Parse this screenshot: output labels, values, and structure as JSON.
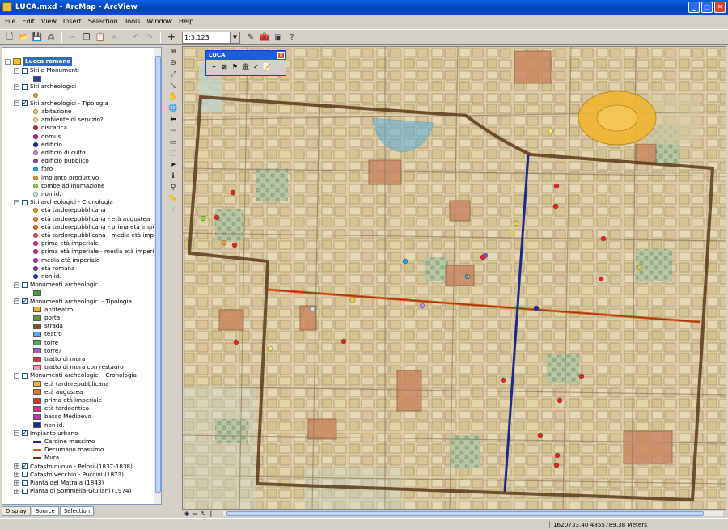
{
  "window": {
    "title": "LUCA.mxd - ArcMap - ArcView"
  },
  "menu": [
    "File",
    "Edit",
    "View",
    "Insert",
    "Selection",
    "Tools",
    "Window",
    "Help"
  ],
  "toolbar": {
    "scale": "1:3.123"
  },
  "luca_toolbar": {
    "title": "LUCA"
  },
  "toc": {
    "root": "Lucca romana",
    "rows": [
      {
        "type": "group",
        "label": "Siti e Monumenti",
        "checked": false
      },
      {
        "type": "sym",
        "sym": "sq",
        "color": "#1c3fae",
        "label": ""
      },
      {
        "type": "group",
        "label": "Siti archeologici",
        "checked": false
      },
      {
        "type": "sym",
        "sym": "dot",
        "color": "#e5a024",
        "label": ""
      },
      {
        "type": "group",
        "label": "Siti archeologici - Tipologia",
        "checked": true
      },
      {
        "type": "sym",
        "sym": "dot",
        "color": "#e6d24a",
        "label": "abitazione"
      },
      {
        "type": "sym",
        "sym": "dot",
        "color": "#ecec70",
        "label": "ambiente di servizio?"
      },
      {
        "type": "sym",
        "sym": "dot",
        "color": "#e0261f",
        "label": "discarica"
      },
      {
        "type": "sym",
        "sym": "dot",
        "color": "#c01f6e",
        "label": "domus"
      },
      {
        "type": "sym",
        "sym": "dot",
        "color": "#1b2aa0",
        "label": "edificio"
      },
      {
        "type": "sym",
        "sym": "dot",
        "color": "#c48ae4",
        "label": "edificio di culto"
      },
      {
        "type": "sym",
        "sym": "dot",
        "color": "#9b44c2",
        "label": "edificio pubblico"
      },
      {
        "type": "sym",
        "sym": "dot",
        "color": "#1da6e0",
        "label": "foro"
      },
      {
        "type": "sym",
        "sym": "dot",
        "color": "#e89a2a",
        "label": "impianto produttivo"
      },
      {
        "type": "sym",
        "sym": "dot",
        "color": "#8ad63c",
        "label": "tombe ad inumazione"
      },
      {
        "type": "sym",
        "sym": "dot",
        "color": "#c8e8e8",
        "label": "non id."
      },
      {
        "type": "group",
        "label": "Siti archeologici - Cronologia",
        "checked": false
      },
      {
        "type": "sym",
        "sym": "dot",
        "color": "#e5a024",
        "label": "età tardorepubblicana"
      },
      {
        "type": "sym",
        "sym": "dot",
        "color": "#e58a24",
        "label": "età tardorepubblicana - età augustea"
      },
      {
        "type": "sym",
        "sym": "dot",
        "color": "#e07030",
        "label": "età tardorepubblicana - prima età imperiale"
      },
      {
        "type": "sym",
        "sym": "dot",
        "color": "#e05050",
        "label": "età tardorepubblicana - media età imperiale"
      },
      {
        "type": "sym",
        "sym": "dot",
        "color": "#e0307a",
        "label": "prima età imperiale"
      },
      {
        "type": "sym",
        "sym": "dot",
        "color": "#d02a8a",
        "label": "prima età imperiale - media età imperiale"
      },
      {
        "type": "sym",
        "sym": "dot",
        "color": "#b0309e",
        "label": "media età imperiale"
      },
      {
        "type": "sym",
        "sym": "dot",
        "color": "#8030b0",
        "label": "età romana"
      },
      {
        "type": "sym",
        "sym": "dot",
        "color": "#2040c0",
        "label": "non id."
      },
      {
        "type": "group",
        "label": "Monumenti archeologici",
        "checked": false
      },
      {
        "type": "sym",
        "sym": "sq",
        "color": "#42a33a",
        "label": ""
      },
      {
        "type": "group",
        "label": "Monumenti archeologici - Tipologia",
        "checked": true
      },
      {
        "type": "sym",
        "sym": "sq",
        "color": "#f0b732",
        "label": "anfiteatro"
      },
      {
        "type": "sym",
        "sym": "sq",
        "color": "#5f9a37",
        "label": "porta"
      },
      {
        "type": "sym",
        "sym": "sq",
        "color": "#7d5030",
        "label": "strada"
      },
      {
        "type": "sym",
        "sym": "sq",
        "color": "#5ab0dd",
        "label": "teatro"
      },
      {
        "type": "sym",
        "sym": "sq",
        "color": "#4aa95a",
        "label": "torre"
      },
      {
        "type": "sym",
        "sym": "sq",
        "color": "#a060c0",
        "label": "torre?"
      },
      {
        "type": "sym",
        "sym": "sq",
        "color": "#d73838",
        "label": "tratto di mura"
      },
      {
        "type": "sym",
        "sym": "sq",
        "color": "#f09ab8",
        "label": "tratto di mura con restauro"
      },
      {
        "type": "group",
        "label": "Monumenti archeologici - Cronologia",
        "checked": false
      },
      {
        "type": "sym",
        "sym": "sq",
        "color": "#f0b732",
        "label": "età tardorepubblicana"
      },
      {
        "type": "sym",
        "sym": "sq",
        "color": "#e5761c",
        "label": "età augustea"
      },
      {
        "type": "sym",
        "sym": "sq",
        "color": "#e03030",
        "label": "prima età imperiale"
      },
      {
        "type": "sym",
        "sym": "sq",
        "color": "#e0308a",
        "label": "età tardoantica"
      },
      {
        "type": "sym",
        "sym": "sq",
        "color": "#c03aa0",
        "label": "basso Medioevo"
      },
      {
        "type": "sym",
        "sym": "sq",
        "color": "#1a2a90",
        "label": "non id."
      },
      {
        "type": "group",
        "label": "Impianto urbano",
        "checked": true
      },
      {
        "type": "sym",
        "sym": "line",
        "color": "#1b2a8a",
        "label": "Cardine massimo"
      },
      {
        "type": "sym",
        "sym": "line",
        "color": "#e05a1a",
        "label": "Decumano massimo"
      },
      {
        "type": "sym",
        "sym": "line",
        "color": "#5a3a1a",
        "label": "Mura"
      },
      {
        "type": "group",
        "label": "Catasto nuovo - Pelosi (1837-1838)",
        "checked": true
      },
      {
        "type": "group",
        "label": "Catasto vecchio - Puccini (1873)",
        "checked": false
      },
      {
        "type": "group",
        "label": "Pianta del Matraia (1843)",
        "checked": false
      },
      {
        "type": "group",
        "label": "Pianta di Sommella-Giuliani (1974)",
        "checked": false
      }
    ]
  },
  "tabs": [
    "Display",
    "Source",
    "Selection"
  ],
  "status": {
    "coordinates": "1620733,40  4855789,38 Meters"
  },
  "colors": {
    "cardine": "#1b2a8a",
    "decumano": "#e05a1a",
    "mura": "#5a3a1a",
    "anfiteatro": "#f0b732",
    "teatro": "#5ab0dd"
  }
}
